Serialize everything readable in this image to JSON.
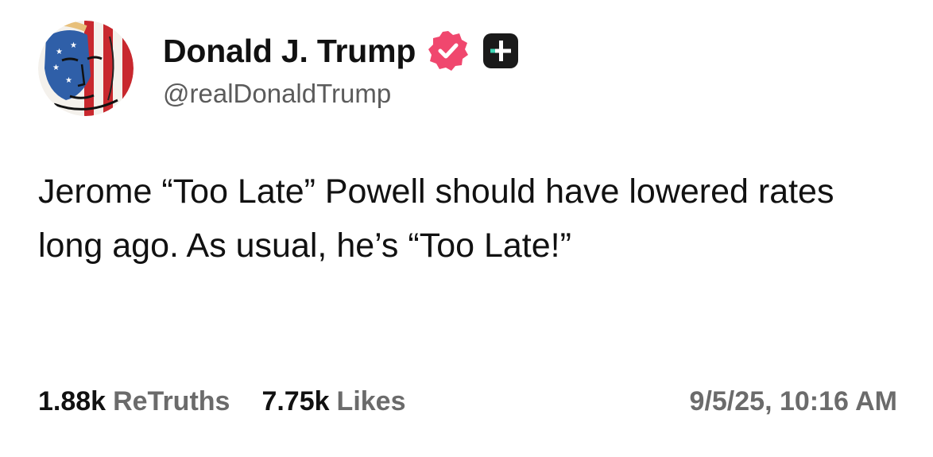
{
  "post": {
    "author": {
      "display_name": "Donald J. Trump",
      "handle": "@realDonaldTrump",
      "avatar_icon": "flag-painted-portrait-avatar",
      "verified_badge_color": "#f0476e",
      "plus_badge_icon": "plus-icon"
    },
    "text": "Jerome “Too Late” Powell should have lowered rates long ago. As usual, he’s “Too Late!”",
    "stats": {
      "retruths_count": "1.88k",
      "retruths_label": "ReTruths",
      "likes_count": "7.75k",
      "likes_label": "Likes"
    },
    "timestamp": "9/5/25, 10:16 AM"
  },
  "colors": {
    "text_primary": "#111111",
    "text_secondary": "#6b6b6b",
    "badge_pink": "#f0476e",
    "badge_plus_bg": "#1a1a1a",
    "badge_plus_accent": "#3dd6b5"
  }
}
